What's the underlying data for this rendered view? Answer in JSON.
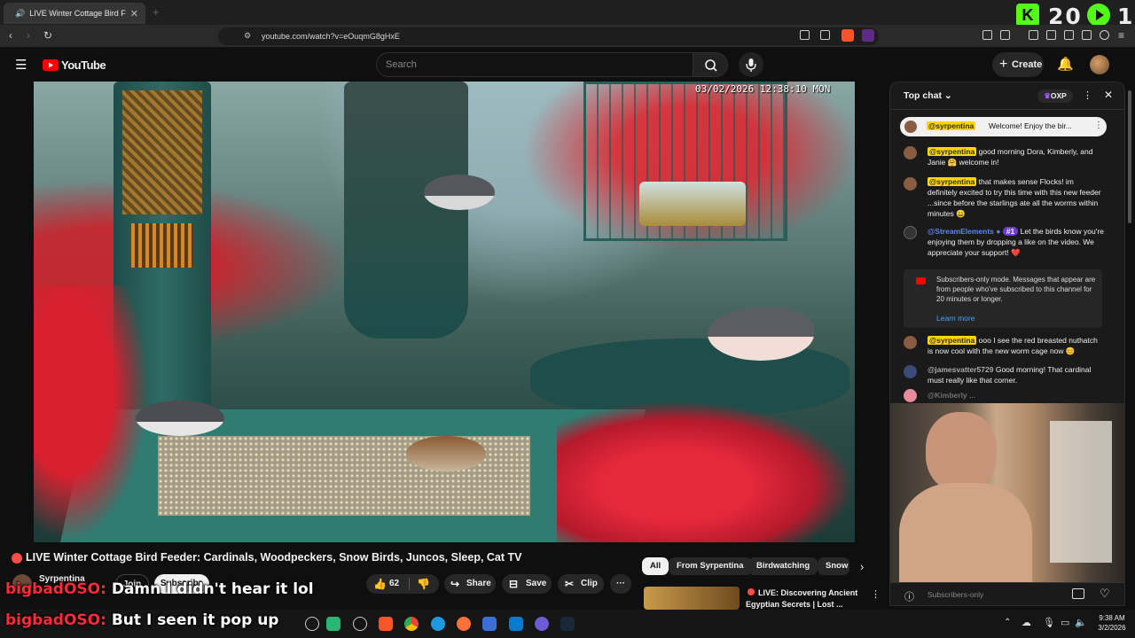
{
  "browser": {
    "tab_title": "LIVE Winter Cottage Bird F",
    "url": "youtube.com/watch?v=eOuqmG8gHxE"
  },
  "overlay_counter": {
    "value_a": "20",
    "value_b": "1"
  },
  "youtube": {
    "logo_text": "YouTube",
    "search_placeholder": "Search",
    "create_label": "Create"
  },
  "video": {
    "timestamp_overlay": "03/02/2026 12:38:10 MON",
    "title": "LIVE Winter Cottage Bird Feeder: Cardinals, Woodpeckers, Snow Birds, Juncos, Sleep, Cat TV",
    "channel_name": "Syrpentina",
    "join_label": "Join",
    "subscribe_label": "Subscribe",
    "likes": "62",
    "share_label": "Share",
    "save_label": "Save",
    "clip_label": "Clip"
  },
  "recommend": {
    "chips": [
      "All",
      "From Syrpentina",
      "Birdwatching",
      "Snow"
    ],
    "next_title": "LIVE: Discovering Ancient Egyptian Secrets | Lost ..."
  },
  "chat": {
    "header": "Top chat",
    "badge": "OXP",
    "pinned_user": "@syrpentina",
    "pinned_text": "Welcome! Enjoy the bir...",
    "messages": [
      {
        "user": "@syrpentina",
        "text": "good morning Dora, Kimberly, and Janie 🤗 welcome in!"
      },
      {
        "user": "@syrpentina",
        "text": "that makes sense Flocks! im definitely excited to try this time with this new feeder ...since before the starlings ate all the worms within minutes 😄"
      },
      {
        "user": "@StreamElements",
        "badge": "#1",
        "text": "Let the birds know you're enjoying them by dropping a like on the video. We appreciate your support! ❤️"
      },
      {
        "user": "@syrpentina",
        "text": "ooo I see the red breasted nuthatch is now cool with the new worm cage now 😊"
      },
      {
        "user": "@jamesvatter5729",
        "text": "Good morning! That cardinal must really like that corner."
      },
      {
        "user": "@Kimberly",
        "text": "..."
      }
    ],
    "notice_text": "Subscribers-only mode. Messages that appear are from people who've subscribed to this channel for 20 minutes or longer.",
    "notice_link": "Learn more",
    "input_placeholder": "Subscribers-only"
  },
  "captions": {
    "line1_user": "bigbadOSO:",
    "line1_text": "Damn I didn't hear it lol",
    "line2_user": "bigbadOSO:",
    "line2_text": "But I seen it pop up"
  },
  "system": {
    "time": "9:38 AM",
    "date": "3/2/2026"
  }
}
